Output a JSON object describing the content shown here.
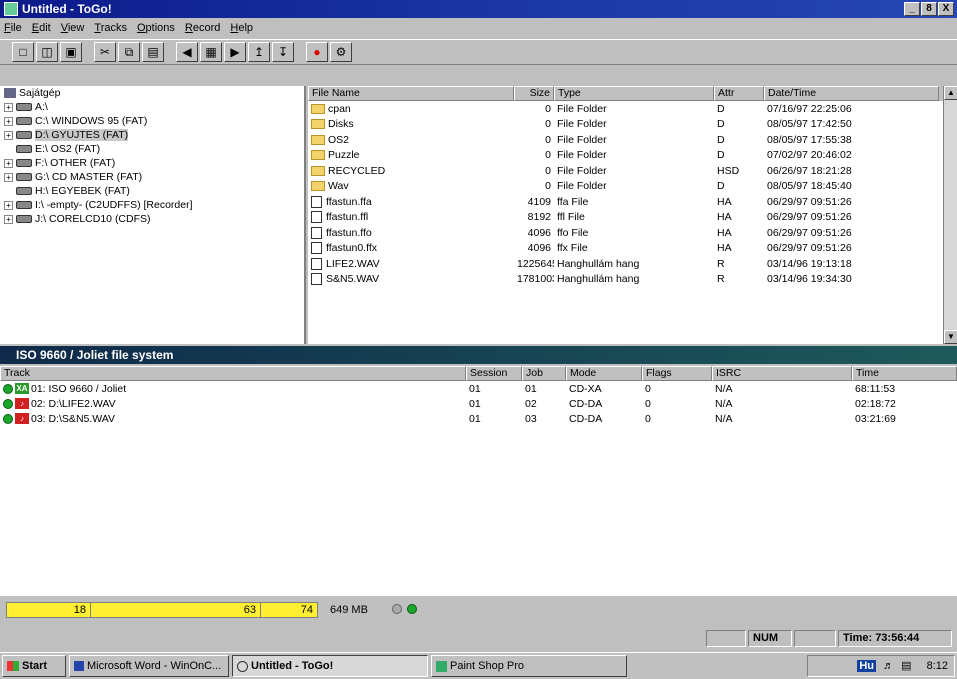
{
  "window": {
    "title": "Untitled - ToGo!",
    "controls": [
      "_",
      "8",
      "X"
    ]
  },
  "menu": [
    "File",
    "Edit",
    "View",
    "Tracks",
    "Options",
    "Record",
    "Help"
  ],
  "toolbar_icons": [
    "new-icon",
    "open-icon",
    "save-icon",
    "cut-icon",
    "copy-icon",
    "paste-icon",
    "left-arrow-icon",
    "grid-icon",
    "right-arrow-icon",
    "up-icon",
    "down-icon",
    "record-icon",
    "play-icon"
  ],
  "tree": {
    "root": "Sajátgép",
    "items": [
      {
        "label": "A:\\",
        "expander": "+"
      },
      {
        "label": "C:\\ WINDOWS 95 (FAT)",
        "expander": "+"
      },
      {
        "label": "D:\\ GYUJTES (FAT)",
        "expander": "+",
        "selected": true
      },
      {
        "label": "E:\\ OS2 (FAT)",
        "expander": ""
      },
      {
        "label": "F:\\ OTHER (FAT)",
        "expander": "+"
      },
      {
        "label": "G:\\ CD MASTER (FAT)",
        "expander": "+"
      },
      {
        "label": "H:\\ EGYEBEK (FAT)",
        "expander": ""
      },
      {
        "label": "I:\\ -empty- (C2UDFFS) [Recorder]",
        "expander": "+"
      },
      {
        "label": "J:\\ CORELCD10 (CDFS)",
        "expander": "+"
      }
    ]
  },
  "files": {
    "headers": [
      "File Name",
      "Size",
      "Type",
      "Attr",
      "Date/Time"
    ],
    "rows": [
      {
        "name": "cpan",
        "size": "0",
        "type": "File Folder",
        "attr": "D",
        "date": "07/16/97 22:25:06",
        "kind": "folder"
      },
      {
        "name": "Disks",
        "size": "0",
        "type": "File Folder",
        "attr": "D",
        "date": "08/05/97 17:42:50",
        "kind": "folder"
      },
      {
        "name": "OS2",
        "size": "0",
        "type": "File Folder",
        "attr": "D",
        "date": "08/05/97 17:55:38",
        "kind": "folder"
      },
      {
        "name": "Puzzle",
        "size": "0",
        "type": "File Folder",
        "attr": "D",
        "date": "07/02/97 20:46:02",
        "kind": "folder"
      },
      {
        "name": "RECYCLED",
        "size": "0",
        "type": "File Folder",
        "attr": "HSD",
        "date": "06/26/97 18:21:28",
        "kind": "folder"
      },
      {
        "name": "Wav",
        "size": "0",
        "type": "File Folder",
        "attr": "D",
        "date": "08/05/97 18:45:40",
        "kind": "folder"
      },
      {
        "name": "ffastun.ffa",
        "size": "4109",
        "type": "ffa File",
        "attr": "HA",
        "date": "06/29/97 09:51:26",
        "kind": "file"
      },
      {
        "name": "ffastun.ffl",
        "size": "8192",
        "type": "ffl File",
        "attr": "HA",
        "date": "06/29/97 09:51:26",
        "kind": "file"
      },
      {
        "name": "ffastun.ffo",
        "size": "4096",
        "type": "ffo File",
        "attr": "HA",
        "date": "06/29/97 09:51:26",
        "kind": "file"
      },
      {
        "name": "ffastun0.ffx",
        "size": "4096",
        "type": "ffx File",
        "attr": "HA",
        "date": "06/29/97 09:51:26",
        "kind": "file"
      },
      {
        "name": "LIFE2.WAV",
        "size": "12256458",
        "type": "Hanghullám hang",
        "attr": "R",
        "date": "03/14/96 19:13:18",
        "kind": "file"
      },
      {
        "name": "S&N5.WAV",
        "size": "17810036",
        "type": "Hanghullám hang",
        "attr": "R",
        "date": "03/14/96 19:34:30",
        "kind": "file"
      }
    ]
  },
  "tracks_panel": {
    "title": "ISO 9660 / Joliet file system",
    "headers": [
      "Track",
      "Session",
      "Job",
      "Mode",
      "Flags",
      "ISRC",
      "Time"
    ],
    "rows": [
      {
        "badge": "XA",
        "badge_color": "#2a9a2a",
        "track": "01: ISO 9660 / Joliet",
        "session": "01",
        "job": "01",
        "mode": "CD-XA",
        "flags": "0",
        "isrc": "N/A",
        "time": "68:11:53"
      },
      {
        "badge": "♪",
        "badge_color": "#d02020",
        "track": "02: D:\\LIFE2.WAV",
        "session": "01",
        "job": "02",
        "mode": "CD-DA",
        "flags": "0",
        "isrc": "N/A",
        "time": "02:18:72"
      },
      {
        "badge": "♪",
        "badge_color": "#d02020",
        "track": "03: D:\\S&N5.WAV",
        "session": "01",
        "job": "03",
        "mode": "CD-DA",
        "flags": "0",
        "isrc": "N/A",
        "time": "03:21:69"
      }
    ]
  },
  "progress": {
    "marks": [
      "18",
      "63",
      "74"
    ],
    "capacity": "649 MB",
    "fill_color": "#ffef33"
  },
  "status": {
    "num": "NUM",
    "time": "Time: 73:56:44"
  },
  "taskbar": {
    "start": "Start",
    "tasks": [
      "Microsoft Word - WinOnC...",
      "Untitled - ToGo!",
      "Paint Shop Pro"
    ],
    "clock": "8:12",
    "tray_lang": "Hu"
  }
}
